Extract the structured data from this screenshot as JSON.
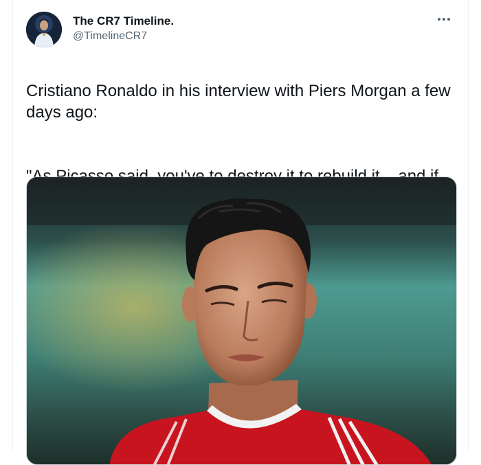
{
  "author": {
    "display_name": "The CR7 Timeline.",
    "handle": "@TimelineCR7",
    "avatar_icon": "profile-photo"
  },
  "menu": {
    "more_icon": "more-horizontal-icon"
  },
  "tweet": {
    "paragraph_1": "Cristiano Ronaldo in his interview with Piers Morgan a few days ago:",
    "paragraph_2": "\"As Picasso said, you've to destroy it to rebuild it... and if they start with me, for me, it’s not a problem.\""
  },
  "media": {
    "type": "photo",
    "subject": "football-player-portrait"
  },
  "colors": {
    "text_primary": "#0f1419",
    "text_secondary": "#536471",
    "border": "#cfd9de",
    "jersey_red": "#c8141f"
  }
}
